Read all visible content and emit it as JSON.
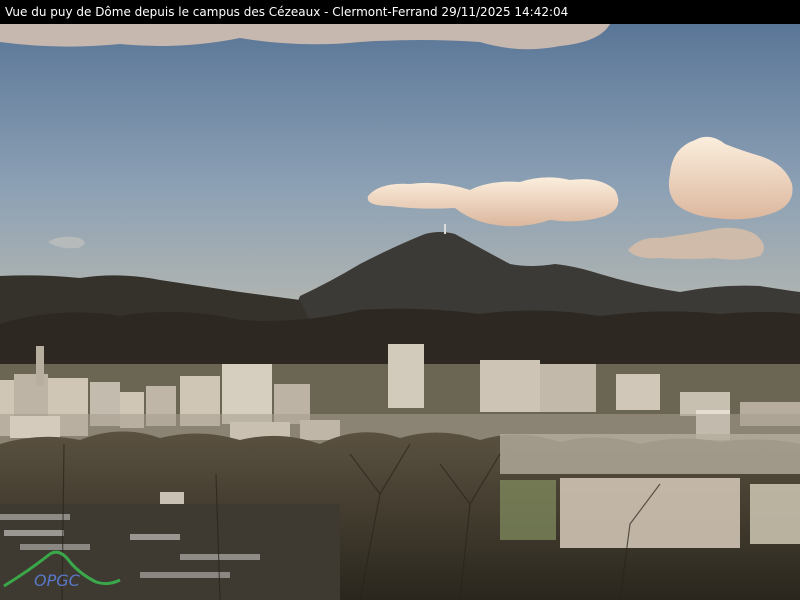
{
  "caption": {
    "text": "Vue du puy de Dôme depuis le campus des Cézeaux - Clermont-Ferrand 29/11/2025 14:42:04"
  },
  "logo": {
    "text": "OPGC",
    "color": "#3aa84a",
    "text_color": "#5a78c8"
  },
  "colors": {
    "sky_top": "#5f7b9c",
    "sky_bottom": "#a7b4bb",
    "cloud": "#f3dcc4",
    "mountain": "#3a3a35",
    "hills": "#2e2b24",
    "city_building": "#cfc6b8",
    "trees": "#3f3a2c"
  }
}
